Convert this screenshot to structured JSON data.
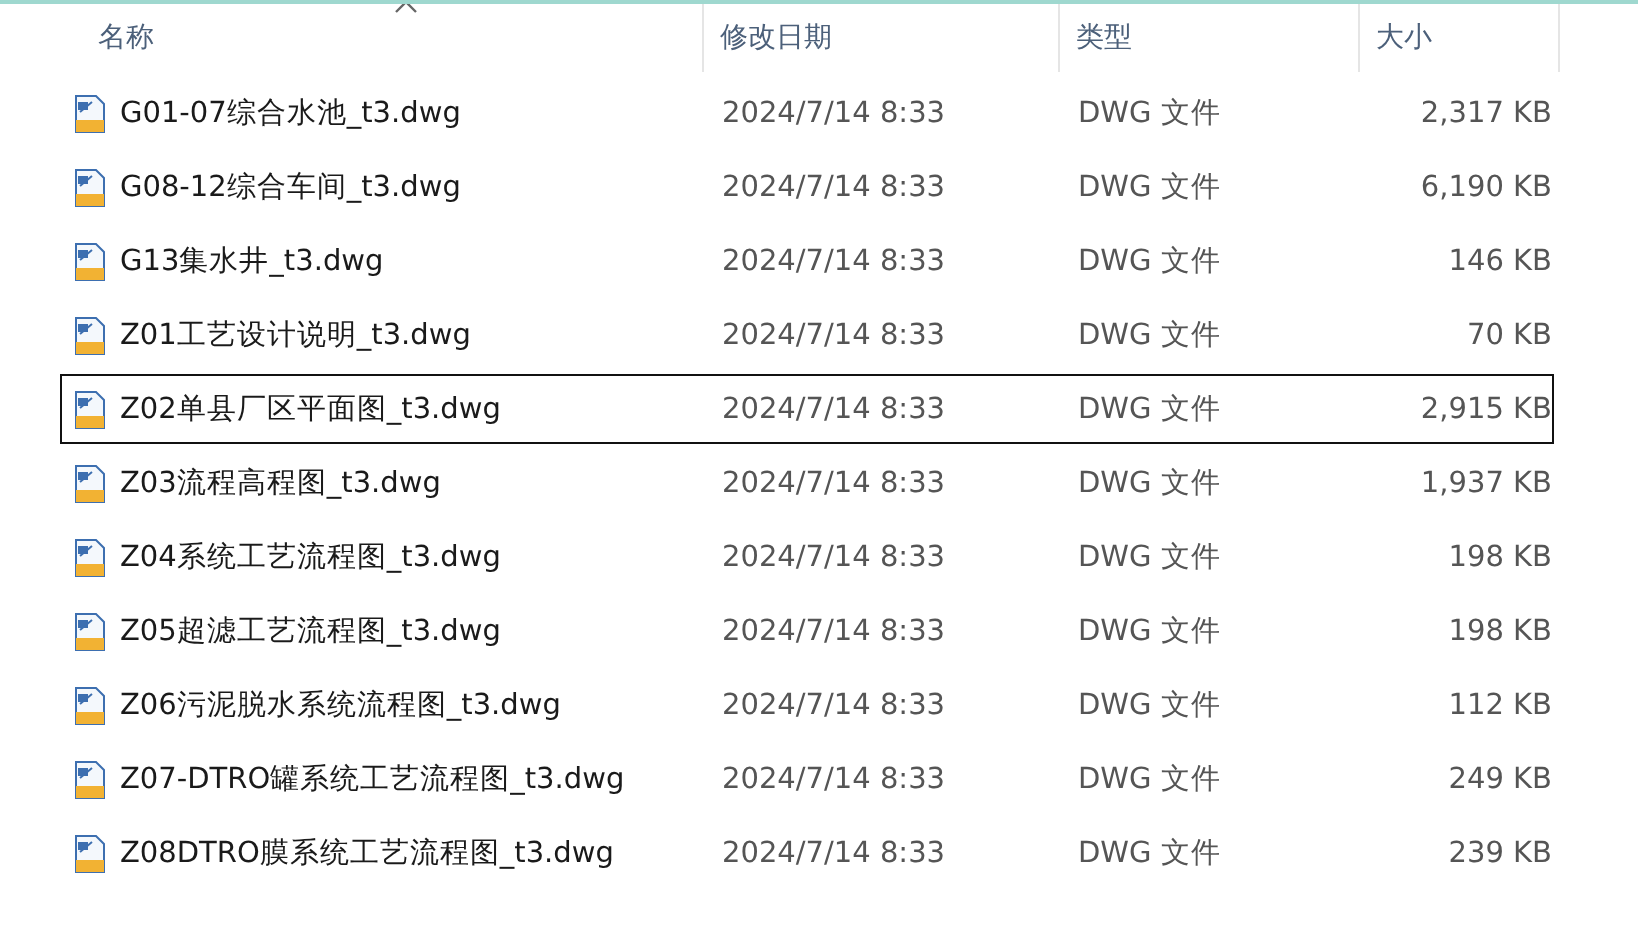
{
  "columns": [
    {
      "label": "名称",
      "sorted": true
    },
    {
      "label": "修改日期",
      "sorted": false
    },
    {
      "label": "类型",
      "sorted": false
    },
    {
      "label": "大小",
      "sorted": false
    }
  ],
  "files": [
    {
      "name": "G01-07综合水池_t3.dwg",
      "modified": "2024/7/14 8:33",
      "type": "DWG 文件",
      "size": "2,317 KB",
      "focused": false
    },
    {
      "name": "G08-12综合车间_t3.dwg",
      "modified": "2024/7/14 8:33",
      "type": "DWG 文件",
      "size": "6,190 KB",
      "focused": false
    },
    {
      "name": "G13集水井_t3.dwg",
      "modified": "2024/7/14 8:33",
      "type": "DWG 文件",
      "size": "146 KB",
      "focused": false
    },
    {
      "name": "Z01工艺设计说明_t3.dwg",
      "modified": "2024/7/14 8:33",
      "type": "DWG 文件",
      "size": "70 KB",
      "focused": false
    },
    {
      "name": "Z02单县厂区平面图_t3.dwg",
      "modified": "2024/7/14 8:33",
      "type": "DWG 文件",
      "size": "2,915 KB",
      "focused": true
    },
    {
      "name": "Z03流程高程图_t3.dwg",
      "modified": "2024/7/14 8:33",
      "type": "DWG 文件",
      "size": "1,937 KB",
      "focused": false
    },
    {
      "name": "Z04系统工艺流程图_t3.dwg",
      "modified": "2024/7/14 8:33",
      "type": "DWG 文件",
      "size": "198 KB",
      "focused": false
    },
    {
      "name": "Z05超滤工艺流程图_t3.dwg",
      "modified": "2024/7/14 8:33",
      "type": "DWG 文件",
      "size": "198 KB",
      "focused": false
    },
    {
      "name": "Z06污泥脱水系统流程图_t3.dwg",
      "modified": "2024/7/14 8:33",
      "type": "DWG 文件",
      "size": "112 KB",
      "focused": false
    },
    {
      "name": "Z07-DTRO罐系统工艺流程图_t3.dwg",
      "modified": "2024/7/14 8:33",
      "type": "DWG 文件",
      "size": "249 KB",
      "focused": false
    },
    {
      "name": "Z08DTRO膜系统工艺流程图_t3.dwg",
      "modified": "2024/7/14 8:33",
      "type": "DWG 文件",
      "size": "239 KB",
      "focused": false
    }
  ]
}
